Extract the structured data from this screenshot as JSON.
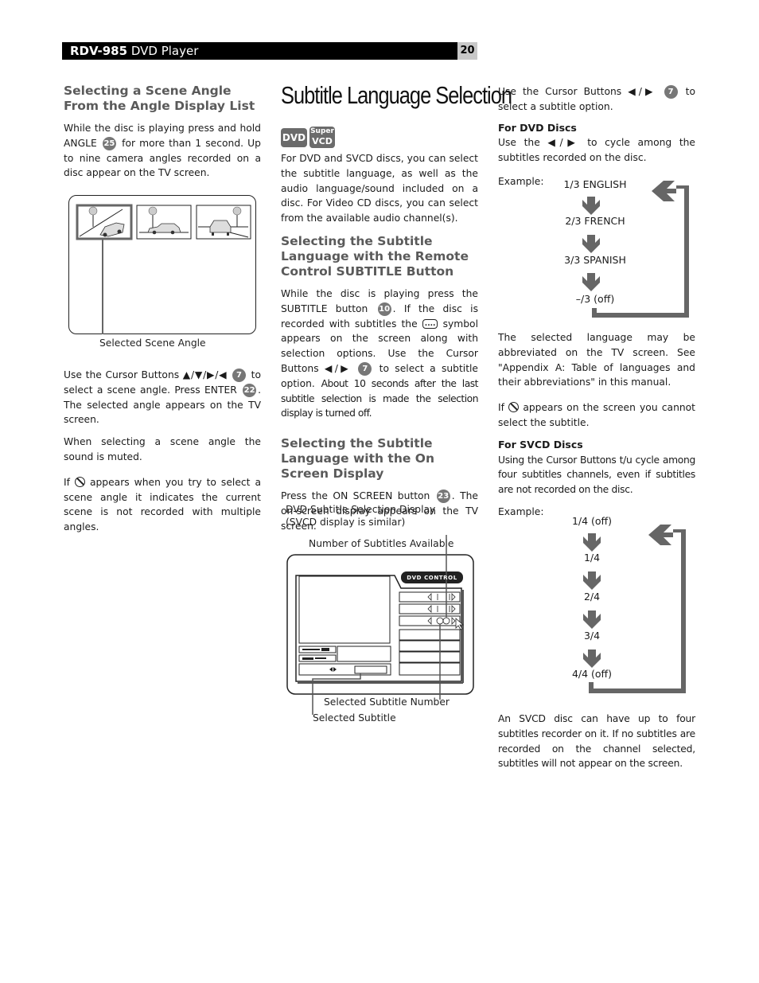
{
  "header": {
    "model": "RDV-985",
    "product": "DVD Player",
    "page_number": "20"
  },
  "left_column": {
    "heading": "Selecting a Scene Angle From the Angle Display List",
    "intro": {
      "before": "While the disc is playing press and hold ANGLE",
      "button_number": "25",
      "after": "for more than 1 second. Up to nine camera angles recorded on a disc appear on the TV screen."
    },
    "figure_caption": "Selected Scene Angle",
    "para_cursor": {
      "before": "Use the Cursor Buttons ▲/▼/▶/◀",
      "button_number": "7",
      "middle": "to select a scene angle. Press ENTER",
      "button_number_2": "22",
      "after": ". The selected angle appears on the TV screen."
    },
    "para_muted": "When selecting a scene angle the sound is muted.",
    "para_prohibit": {
      "before": "If",
      "after": "appears when you try to select a scene angle it indicates the current scene is not recorded with multiple angles."
    }
  },
  "middle_column": {
    "title": "Subtitle Language Selection",
    "badges": {
      "dvd": "DVD",
      "super": "Super",
      "vcd": "VCD"
    },
    "intro": "For DVD and SVCD discs, you can select the subtitle language, as well as the audio language/sound included on a disc. For Video CD discs, you can select from the available audio channel(s).",
    "section1": {
      "heading": "Selecting the Subtitle Language with the Remote Control SUBTITLE Button",
      "text": {
        "p1": "While the disc is playing press the SUBTITLE button",
        "button_number": "10",
        "p2": ". If the disc is recorded with subtitles the",
        "symbol": "....",
        "p3": "symbol appears on the screen along with selection options. Use the Cursor Buttons ◀/▶",
        "button_number_2": "7",
        "p4": "to select a subtitle option.",
        "p5": "About 10 seconds after the last subtitle selection is made the selection display is turned off."
      }
    },
    "section2": {
      "heading": "Selecting the Subtitle Language with the On Screen Display",
      "text": {
        "before": "Press the ON SCREEN button",
        "button_number": "23",
        "after": ". The on-screen display appears on the TV screen."
      }
    },
    "figure": {
      "caption_line1": "DVD Subtitle Selection Display",
      "caption_line2": "(SVCD display is similar)",
      "label_number_available": "Number of Subtitles Available",
      "osd_title": "DVD CONTROL",
      "label_selected_number": "Selected Subtitle Number",
      "label_selected_subtitle": "Selected Subtitle"
    }
  },
  "right_column": {
    "intro": {
      "before": "Use the Cursor Buttons ◀/▶",
      "button_number": "7",
      "after": "to select a subtitle option."
    },
    "dvd": {
      "heading": "For DVD Discs",
      "text": "Use the ◀/▶ to cycle among the subtitles recorded on the disc.",
      "example_label": "Example:",
      "sequence": [
        "1/3 ENGLISH",
        "2/3 FRENCH",
        "3/3 SPANISH",
        "–/3 (off)"
      ]
    },
    "abbrev_note": "The selected language may be abbreviated on the TV screen. See \"Appendix A: Table of languages and their abbreviations\" in this manual.",
    "prohibit_note": {
      "before": "If",
      "after": "appears on the screen you cannot select the subtitle."
    },
    "svcd": {
      "heading": "For SVCD Discs",
      "text": "Using the Cursor Buttons t/u cycle among four subtitles channels, even if subtitles are not recorded on the disc.",
      "example_label": "Example:",
      "sequence": [
        "1/4 (off)",
        "1/4",
        "2/4",
        "3/4",
        "4/4 (off)"
      ]
    },
    "final_note": "An SVCD disc can have up to four subtitles recorder on it. If no subtitles are recorded on the channel selected, subtitles will not appear on the screen."
  },
  "colors": {
    "header_bg": "#000000",
    "page_number_bg": "#c8c8c8",
    "heading_gray": "#5a5a5a",
    "accent_gray": "#6b6b6b"
  }
}
